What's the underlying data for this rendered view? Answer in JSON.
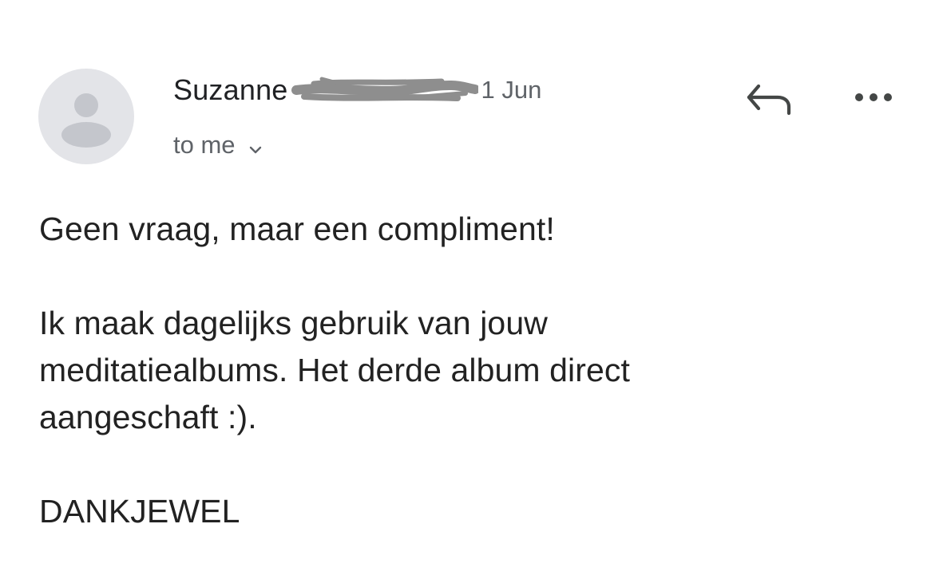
{
  "email": {
    "sender_name": "Suzanne",
    "sender_redacted": true,
    "date": "1 Jun",
    "recipient": "to me",
    "paragraphs": [
      "Geen vraag, maar een compliment!",
      "Ik maak dagelijks gebruik van jouw\nmeditatiealbums. Het derde album direct\naangeschaft :).",
      "DANKJEWEL"
    ]
  },
  "icons": {
    "avatar": "person-avatar-icon",
    "reply": "reply-arrow-icon",
    "more": "more-horizontal-icon",
    "recipient_toggle": "chevron-down-icon"
  },
  "colors": {
    "avatar_bg": "#e3e4e8",
    "avatar_figure": "#c4c6cc",
    "text_primary": "#222222",
    "text_secondary": "#5f6368",
    "icon": "#444746",
    "redaction": "#8e8e8e"
  }
}
